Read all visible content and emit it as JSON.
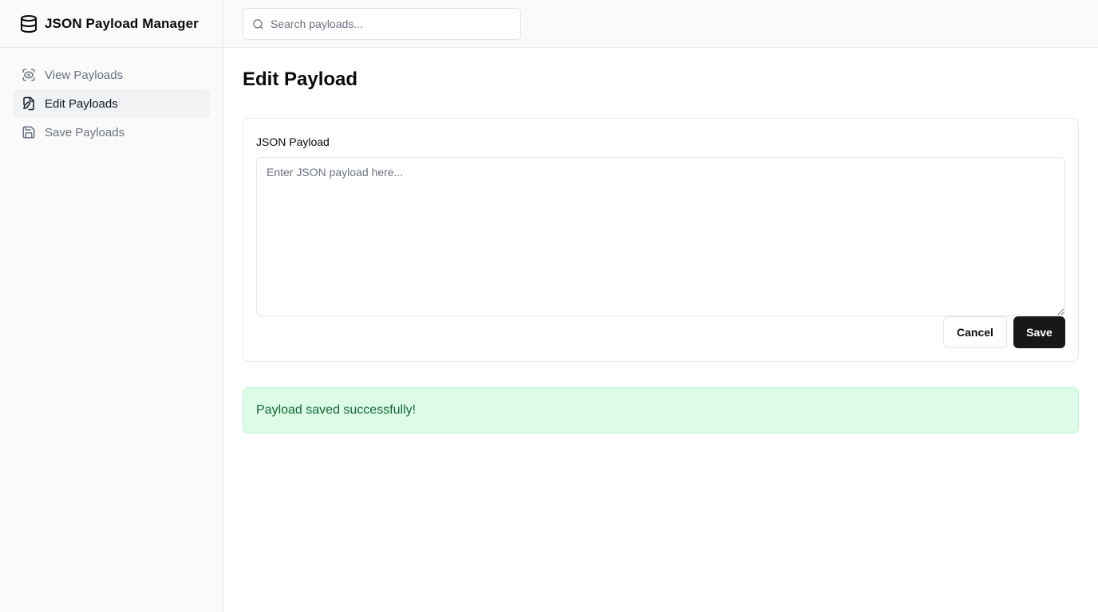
{
  "app": {
    "title": "JSON Payload Manager",
    "icon": "database-icon"
  },
  "sidebar": {
    "items": [
      {
        "label": "View Payloads",
        "icon": "eye-scan-icon",
        "active": false
      },
      {
        "label": "Edit Payloads",
        "icon": "file-edit-icon",
        "active": true
      },
      {
        "label": "Save Payloads",
        "icon": "floppy-disk-icon",
        "active": false
      }
    ]
  },
  "search": {
    "placeholder": "Search payloads...",
    "value": "",
    "icon": "search-icon"
  },
  "main": {
    "title": "Edit Payload",
    "editor": {
      "label": "JSON Payload",
      "placeholder": "Enter JSON payload here...",
      "value": ""
    },
    "buttons": {
      "cancel": "Cancel",
      "save": "Save"
    },
    "alert": {
      "message": "Payload saved successfully!",
      "color": "#166534",
      "background": "#dcfce7"
    }
  },
  "colors": {
    "primary": "#18181b",
    "muted_text": "#6b7280",
    "success": "#166534"
  }
}
